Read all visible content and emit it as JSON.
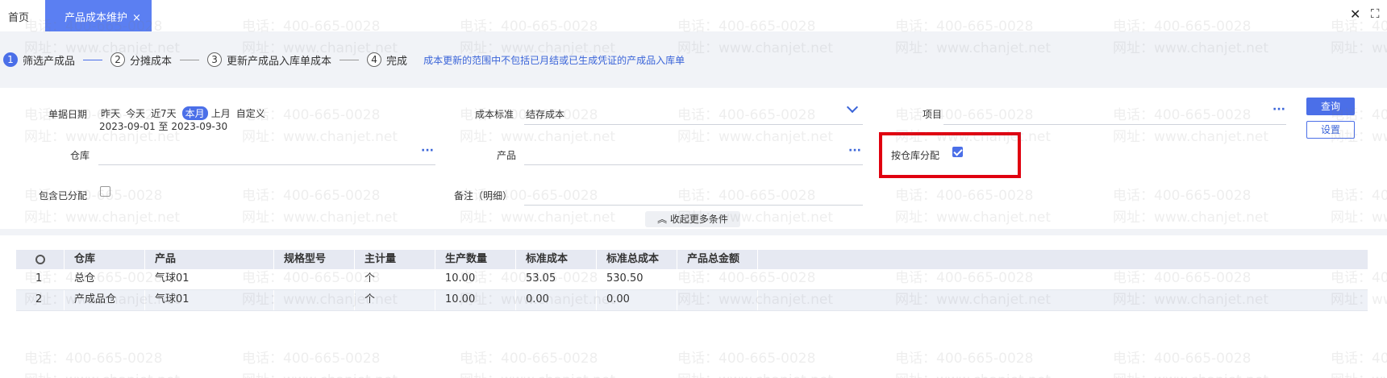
{
  "tabs": {
    "home": "首页",
    "active": "产品成本维护",
    "active_close": "×"
  },
  "window": {
    "close": "✕",
    "maximize": "⛶"
  },
  "steps": [
    {
      "num": "1",
      "label": "筛选产成品"
    },
    {
      "num": "2",
      "label": "分摊成本"
    },
    {
      "num": "3",
      "label": "更新产成品入库单成本"
    },
    {
      "num": "4",
      "label": "完成"
    }
  ],
  "step_note": "成本更新的范围中不包括已月结或已生成凭证的产成品入库单",
  "filters": {
    "date_label": "单据日期",
    "date_options": [
      "昨天",
      "今天",
      "近7天",
      "本月",
      "上月",
      "自定义"
    ],
    "date_selected": "本月",
    "date_range": "2023-09-01 至 2023-09-30",
    "cost_standard_label": "成本标准",
    "cost_standard_value": "结存成本",
    "project_label": "项目",
    "warehouse_label": "仓库",
    "product_label": "产品",
    "by_warehouse_label": "按仓库分配",
    "by_warehouse_checked": true,
    "include_allocated_label": "包含已分配",
    "include_allocated_checked": false,
    "remark_label": "备注（明细）",
    "collapse_label": "收起更多条件",
    "ellipsis": "···"
  },
  "buttons": {
    "query": "查询",
    "settings": "设置"
  },
  "table": {
    "columns": [
      "仓库",
      "产品",
      "规格型号",
      "主计量",
      "生产数量",
      "标准成本",
      "标准总成本",
      "产品总金额"
    ],
    "rows": [
      [
        "1",
        "总仓",
        "气球01",
        "",
        "个",
        "10.00",
        "53.05",
        "530.50",
        ""
      ],
      [
        "2",
        "产成品仓",
        "气球01",
        "",
        "个",
        "10.00",
        "0.00",
        "0.00",
        ""
      ]
    ]
  },
  "watermark": {
    "phone": "电话：400-665-0028",
    "site": "网址：www.chanjet.net"
  },
  "colors": {
    "accent": "#4b6fe8",
    "highlight": "#e0000f",
    "band": "#f1f3f7"
  }
}
